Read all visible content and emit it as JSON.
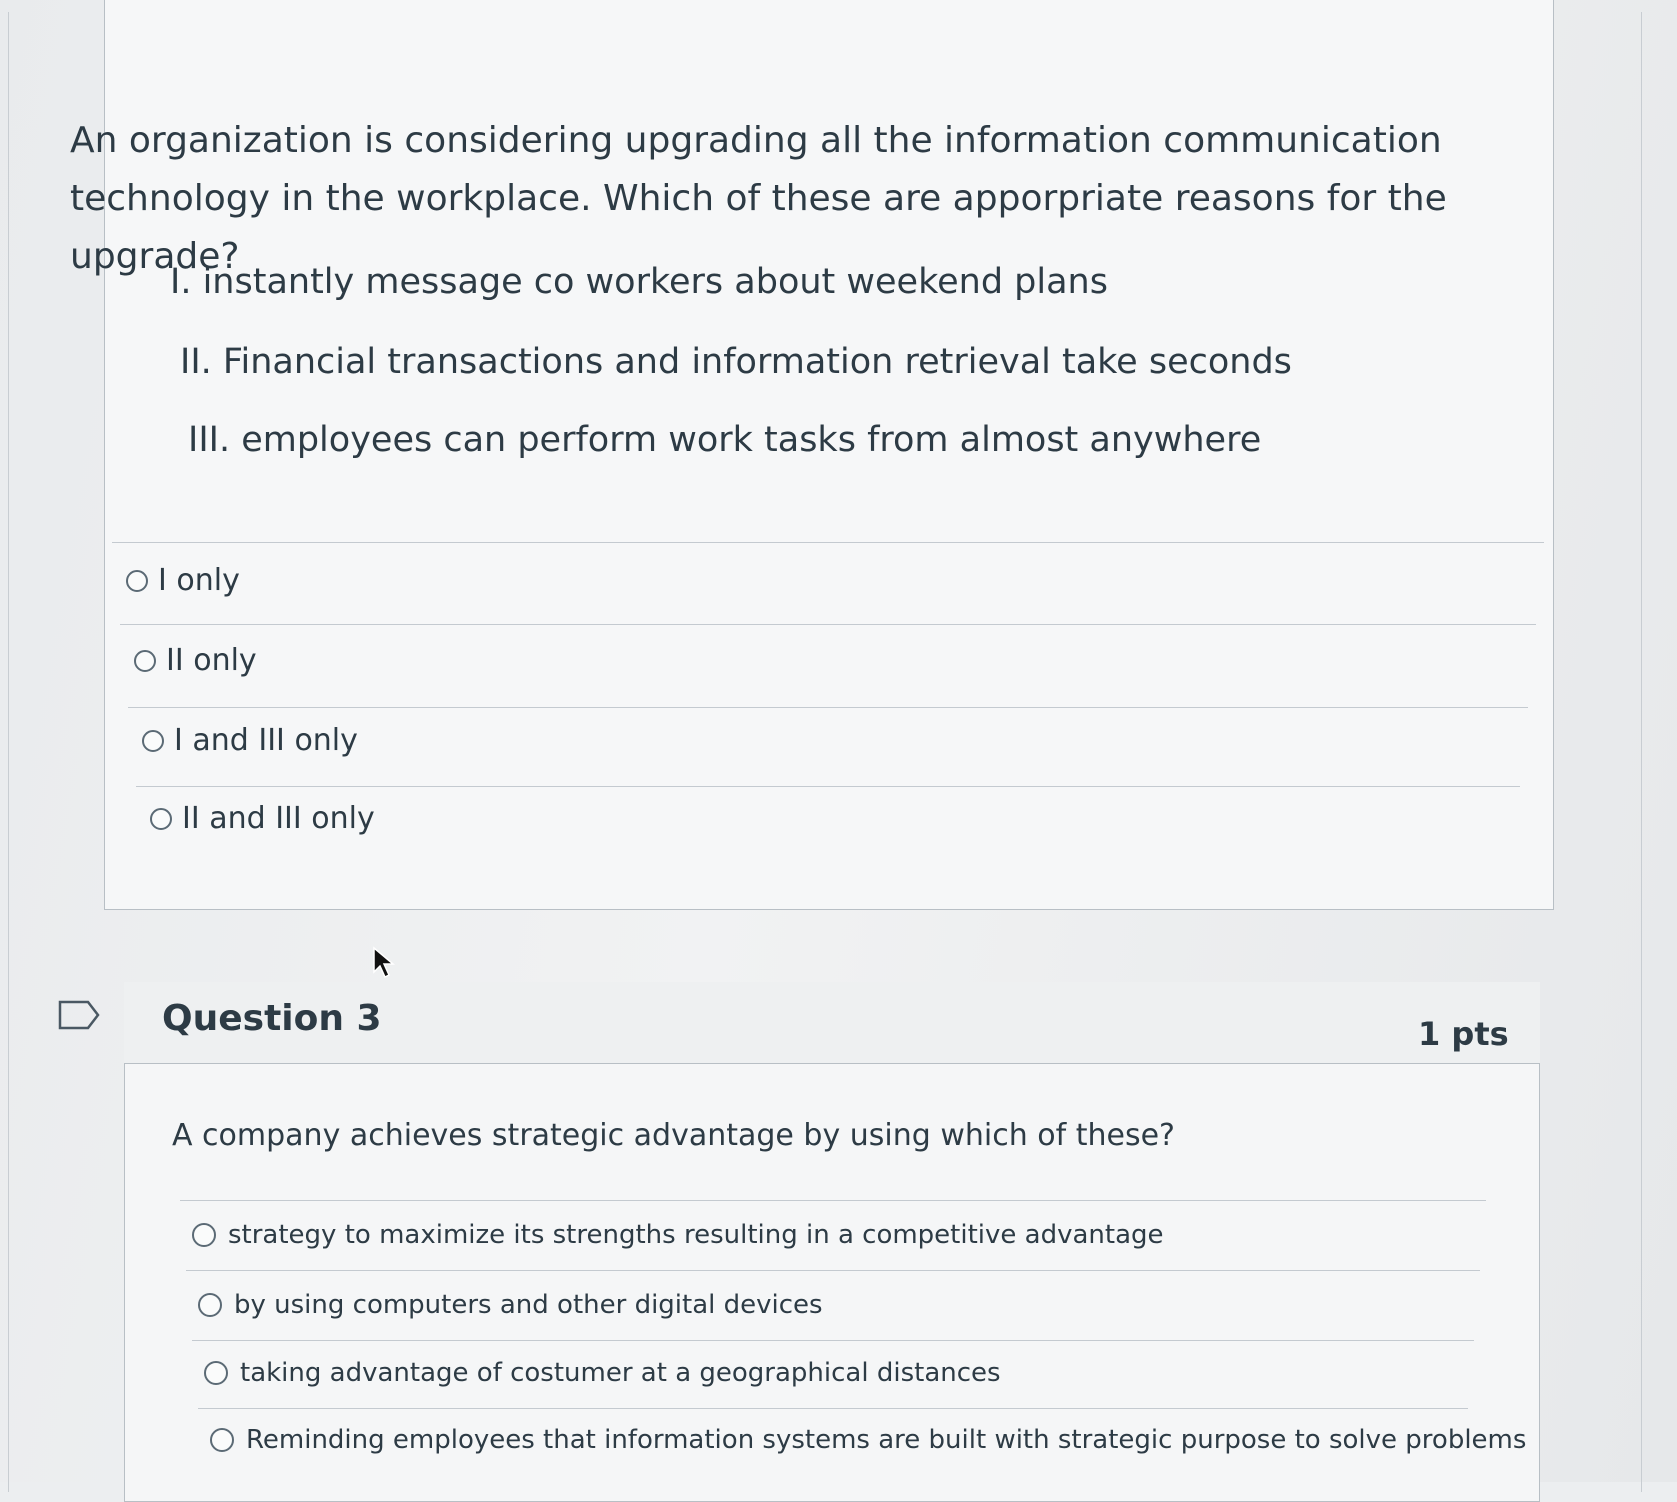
{
  "question2": {
    "prompt": "An organization is considering upgrading all the information communication technology in the workplace. Which of these are apporpriate reasons for the upgrade?",
    "statements": [
      "I. instantly message co workers about weekend plans",
      "II. Financial transactions and information retrieval take seconds",
      "III. employees can perform work tasks from almost anywhere"
    ],
    "options": [
      "I only",
      "II only",
      "I and III only",
      "II and III only"
    ]
  },
  "question3": {
    "title": "Question 3",
    "points": "1 pts",
    "prompt": "A company achieves strategic advantage by using which of these?",
    "options": [
      "strategy to maximize its strengths resulting in a competitive advantage",
      "by using computers and other digital devices",
      "taking advantage of costumer at a geographical distances",
      "Reminding employees that information systems are built with strategic purpose to solve problems"
    ]
  }
}
